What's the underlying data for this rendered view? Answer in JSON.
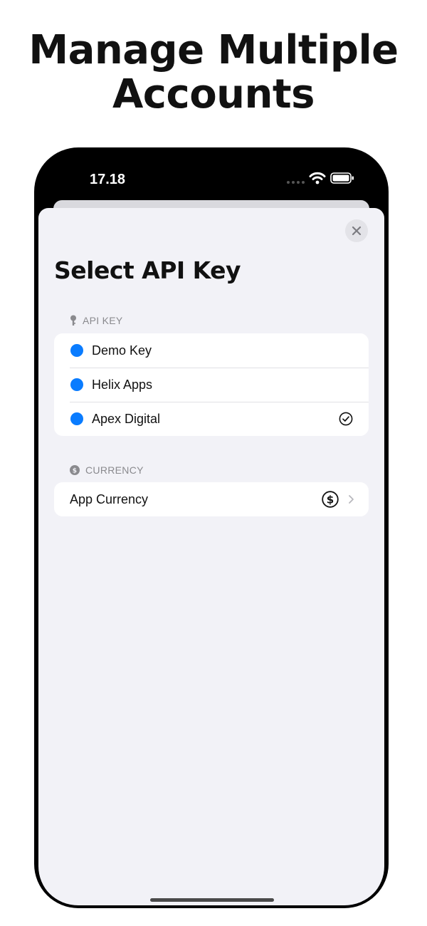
{
  "promo": {
    "title_line1": "Manage Multiple",
    "title_line2": "Accounts"
  },
  "status_bar": {
    "time": "17.18",
    "icons": [
      "signal-icon",
      "wifi-icon",
      "battery-icon"
    ]
  },
  "sheet": {
    "title": "Select API Key",
    "close_icon": "close-icon",
    "api_key_section": {
      "header": "API KEY",
      "icon": "key-icon",
      "items": [
        {
          "label": "Demo Key",
          "color": "#0a7cff",
          "selected": false
        },
        {
          "label": "Helix Apps",
          "color": "#0a7cff",
          "selected": false
        },
        {
          "label": "Apex Digital",
          "color": "#0a7cff",
          "selected": true
        }
      ]
    },
    "currency_section": {
      "header": "CURRENCY",
      "icon": "dollar-circle-icon",
      "row_label": "App Currency",
      "row_icon": "dollar-icon"
    }
  },
  "colors": {
    "accent": "#0a7cff",
    "sheet_background": "#f2f2f7",
    "secondary_text": "#8a8a8e"
  }
}
